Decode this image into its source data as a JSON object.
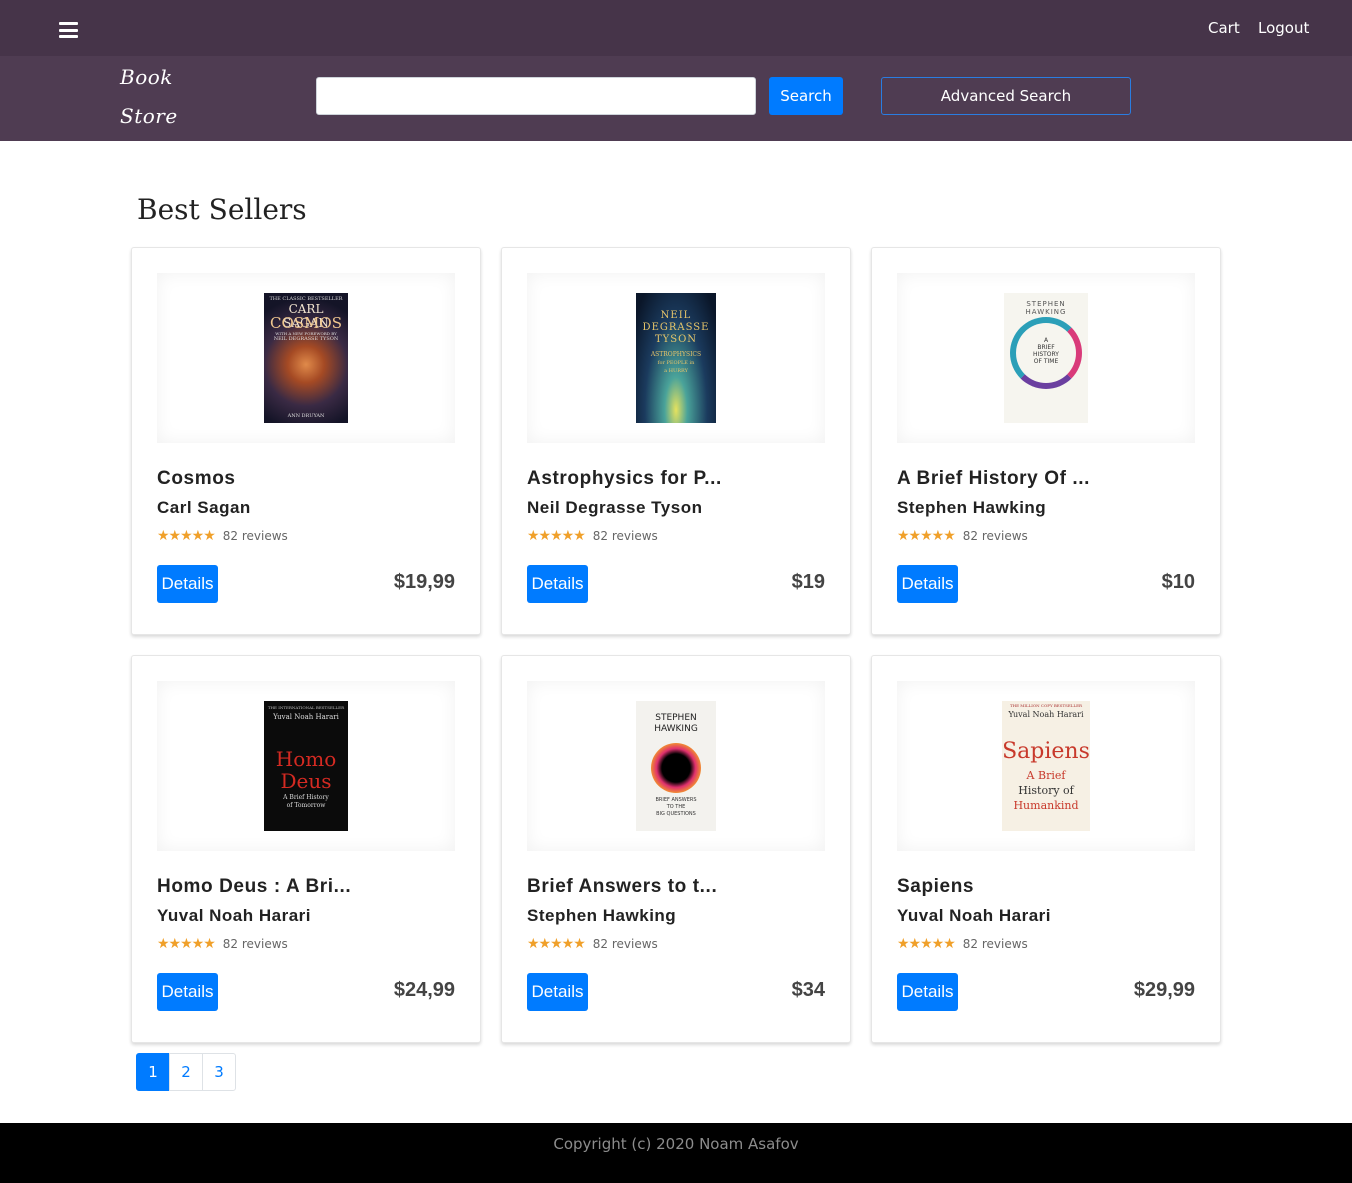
{
  "nav": {
    "cart_label": "Cart",
    "logout_label": "Logout"
  },
  "header": {
    "logo_line1": "Book",
    "logo_line2": "Store",
    "search_placeholder": "",
    "search_label": "Search",
    "advanced_label": "Advanced Search"
  },
  "section": {
    "title": "Best Sellers"
  },
  "books": [
    {
      "title": "Cosmos",
      "author": "Carl Sagan",
      "reviews": "82 reviews",
      "price": "$19,99",
      "details_label": "Details",
      "rating": 4.5,
      "cover_lines": [
        "THE CLASSIC BESTSELLER",
        "CARL SAGAN",
        "COSMOS",
        "WITH A NEW FOREWORD BY",
        "NEIL DEGRASSE TYSON",
        "ANN DRUYAN"
      ]
    },
    {
      "title": "Astrophysics for P...",
      "author": "Neil Degrasse Tyson",
      "reviews": "82 reviews",
      "price": "$19",
      "details_label": "Details",
      "rating": 4.5,
      "cover_lines": [
        "NEIL",
        "DEGRASSE",
        "TYSON",
        "ASTROPHYSICS",
        "for PEOPLE in",
        "a HURRY"
      ]
    },
    {
      "title": "A Brief History Of ...",
      "author": "Stephen Hawking",
      "reviews": "82 reviews",
      "price": "$10",
      "details_label": "Details",
      "rating": 4.5,
      "cover_lines": [
        "STEPHEN",
        "HAWKING",
        "A",
        "BRIEF",
        "HISTORY",
        "OF TIME"
      ]
    },
    {
      "title": "Homo Deus : A Bri...",
      "author": "Yuval Noah Harari",
      "reviews": "82 reviews",
      "price": "$24,99",
      "details_label": "Details",
      "rating": 4.5,
      "cover_lines": [
        "THE INTERNATIONAL BESTSELLER",
        "Yuval Noah Harari",
        "Homo",
        "Deus",
        "A Brief History",
        "of Tomorrow"
      ]
    },
    {
      "title": "Brief Answers to t...",
      "author": "Stephen Hawking",
      "reviews": "82 reviews",
      "price": "$34",
      "details_label": "Details",
      "rating": 4.5,
      "cover_lines": [
        "STEPHEN",
        "HAWKING",
        "BRIEF ANSWERS",
        "TO THE",
        "BIG QUESTIONS"
      ]
    },
    {
      "title": "Sapiens",
      "author": "Yuval Noah Harari",
      "reviews": "82 reviews",
      "price": "$29,99",
      "details_label": "Details",
      "rating": 4.5,
      "cover_lines": [
        "THE MILLION COPY BESTSELLER",
        "Yuval Noah Harari",
        "Sapiens",
        "A Brief",
        "History of",
        "Humankind"
      ]
    }
  ],
  "pagination": {
    "pages": [
      "1",
      "2",
      "3"
    ],
    "active": "1"
  },
  "footer": {
    "copyright": "Copyright (c) 2020 Noam Asafov"
  },
  "colors": {
    "topbar": "#463449",
    "searchbar": "#4f3c52",
    "primary": "#007bff",
    "star": "#f0a02a",
    "footer": "#000000"
  }
}
